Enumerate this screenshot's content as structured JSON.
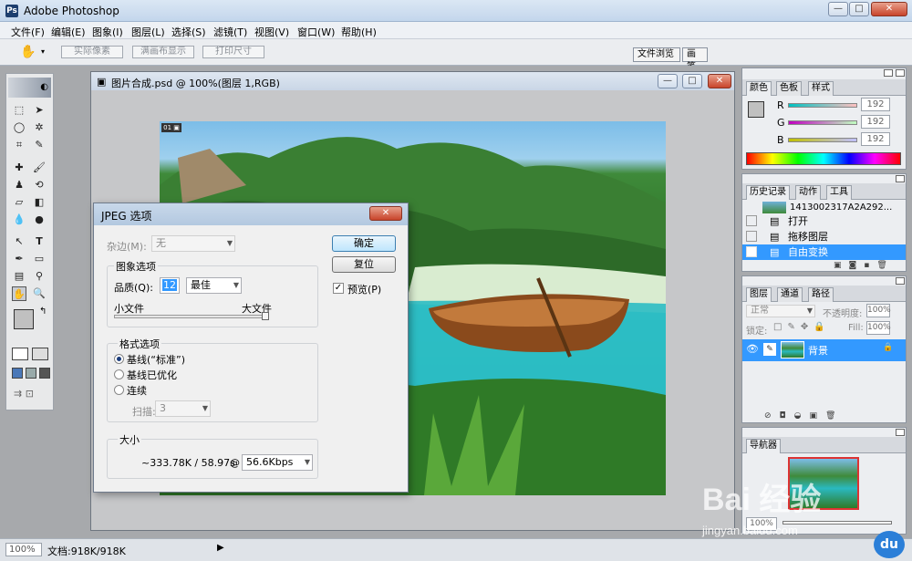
{
  "app": {
    "title": "Adobe Photoshop"
  },
  "menu": [
    "文件(F)",
    "编辑(E)",
    "图象(I)",
    "图层(L)",
    "选择(S)",
    "滤镜(T)",
    "视图(V)",
    "窗口(W)",
    "帮助(H)"
  ],
  "options_bar": {
    "buttons": [
      "实际像素",
      "满画布显示",
      "打印尺寸"
    ],
    "tabs": [
      "文件浏览",
      "画笔"
    ]
  },
  "document": {
    "title": "图片合成.psd @ 100%(图层 1,RGB)"
  },
  "jpeg_dialog": {
    "title": "JPEG 选项",
    "matte_label": "杂边(M):",
    "matte_value": "无",
    "ok": "确定",
    "reset": "复位",
    "preview_label": "预览(P)",
    "preview_checked": true,
    "image_options_legend": "图象选项",
    "quality_label": "品质(Q):",
    "quality_value": "12",
    "quality_preset": "最佳",
    "small_file": "小文件",
    "large_file": "大文件",
    "format_legend": "格式选项",
    "format_options": [
      "基线(“标准”)",
      "基线已优化",
      "连续"
    ],
    "format_selected": 0,
    "scans_label": "扫描:",
    "scans_value": "3",
    "size_legend": "大小",
    "size_text": "~333.78K / 58.97s",
    "at": "@",
    "speed": "56.6Kbps"
  },
  "color_panel": {
    "tabs": [
      "颜色",
      "色板",
      "样式"
    ],
    "channels": [
      {
        "label": "R",
        "value": "192"
      },
      {
        "label": "G",
        "value": "192"
      },
      {
        "label": "B",
        "value": "192"
      }
    ]
  },
  "history_panel": {
    "tabs": [
      "历史记录",
      "动作",
      "工具"
    ],
    "snapshot": "1413002317A2A292...",
    "items": [
      "打开",
      "拖移图层",
      "自由变换"
    ],
    "selected": 2
  },
  "layers_panel": {
    "tabs": [
      "图层",
      "通道",
      "路径"
    ],
    "blend_mode": "正常",
    "opacity_label": "不透明度:",
    "opacity": "100%",
    "lock_label": "锁定:",
    "fill_label": "Fill:",
    "fill": "100%",
    "layer_name": "背景"
  },
  "navigator_panel": {
    "tab": "导航器",
    "zoom": "100%"
  },
  "status": {
    "zoom": "100%",
    "doc_info": "文档:918K/918K"
  },
  "watermark": {
    "brand": "Bai 经验",
    "url": "jingyan.baidu.com"
  },
  "colors": {
    "selection": "#3399ff",
    "accent": "#1d3e6e"
  }
}
